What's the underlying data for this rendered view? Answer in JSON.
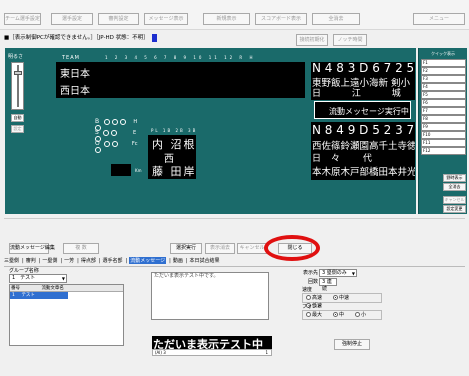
{
  "toolbar": {
    "buttons": [
      "チーム選手設定",
      "選手設定",
      "審判設定",
      "メッセージ表示",
      "新規表示",
      "スコアボード表示",
      "全消去",
      "メニュー"
    ]
  },
  "status": {
    "text": "■［表示制御PCが確認できません。］［JP-HD 状態：不明］",
    "btn_initialize": "接続初期化",
    "btn_history": "ノッチ時間"
  },
  "board": {
    "team_label": "TEAM",
    "inning_numbers": "1 2 3 4 5 6 7 8 9 10 11 12 R H",
    "team1": "東日本",
    "team2": "西日本",
    "brightness_label": "明るさ",
    "auto_label": "自動",
    "manual_label": "設定",
    "bso": [
      {
        "label": "B",
        "dots": 3,
        "extra": "H"
      },
      {
        "label": "S",
        "dots": 2,
        "extra": "E"
      },
      {
        "label": "O",
        "dots": 2,
        "extra": "Fc"
      }
    ],
    "umpire_header": "PL 1B 2B 3B",
    "umpires_row1": "内 沼根",
    "umpires_row2": "西",
    "umpires_row3": "藤 田岸",
    "km_label": "Km",
    "lineup_top_numbers": "N 4 8 3 D 6 7 2 5 9 P",
    "lineup_top_row1": "東野飯上遠小海新 剣小",
    "lineup_top_row2": "日 江 城",
    "message_label": "流動メッセージ実行中",
    "lineup_bottom_numbers": "N 8 4 9 D 5 2 3 7 6 P",
    "lineup_bottom_row1": "西佐篠鈴瀬園高千土寺徳",
    "lineup_bottom_row2": "日々 代",
    "lineup_bottom_row3": "本木原木戸部橋田本井光"
  },
  "rightpanel": {
    "title": "クイック表示",
    "items": [
      "F1",
      "F2",
      "F3",
      "F4",
      "F5",
      "F6",
      "F7",
      "F8",
      "F9",
      "F10",
      "F11",
      "F12"
    ],
    "btn_ball_count": "野時表示",
    "btn_clear_all": "全消去",
    "btn_cancel": "キャンセル",
    "btn_settings": "設定変更"
  },
  "panel": {
    "edit_button": "流動メッセージ編集",
    "copy_button": "複 数",
    "run_button": "選択実行",
    "stop_button": "表示消去",
    "cancel_button": "キャンセル",
    "close_button": "閉じる",
    "tabs": [
      "三塁側",
      "審判",
      "一塁側",
      "一芳",
      "得点部",
      "選手名部",
      "流動メッセージ",
      "動画",
      "本日試合結果"
    ],
    "group_label": "グループ名称",
    "group_value": "1　テスト",
    "table_headers": [
      "番号",
      "流動文章名"
    ],
    "table_rows": [
      [
        "1",
        "テスト"
      ]
    ],
    "message_text": "ただいま表示テスト中です。",
    "display_target_label": "表示先",
    "display_target_value": "3 塁側のみ",
    "count_label": "回数",
    "count_value": "3 連続",
    "speed_label": "速度",
    "speed_options": [
      "高速",
      "中速",
      "低速"
    ],
    "speed_selected": 1,
    "font_label": "フォント",
    "font_options": [
      "最大",
      "中",
      "小"
    ],
    "font_selected": 1,
    "preview_text": "ただいま表示テスト中",
    "preview_counter": "1",
    "preview_footer": "(Al) 3",
    "force_stop_button": "強制停止"
  }
}
